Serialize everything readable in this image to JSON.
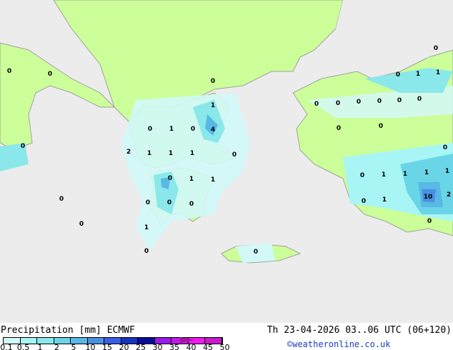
{
  "title": "Precipitation [mm]  ECMWF",
  "valid_time": "Th 23-04-2026 03..06 UTC (06+120)",
  "credit": "©weatheronline.co.uk",
  "colors": {
    "land": "#ccff99",
    "sea": "#ececec",
    "border": "#a0a0a0"
  },
  "colorbar": {
    "ticks": [
      "0.1",
      "0.5",
      "1",
      "2",
      "5",
      "10",
      "15",
      "20",
      "25",
      "30",
      "35",
      "40",
      "45",
      "50"
    ],
    "colors": [
      "#d2f8f8",
      "#a8f5f5",
      "#8ae8ea",
      "#6ad5e6",
      "#58b8e6",
      "#4a90e0",
      "#3a5ce8",
      "#1a32c0",
      "#0a0a9a",
      "#9a1ae8",
      "#c01ae8",
      "#f01af0",
      "#c81ac8",
      "#a0189e"
    ]
  },
  "map": {
    "labels": [
      "0",
      "0",
      "0",
      "1",
      "0",
      "1",
      "0",
      "4",
      "2",
      "1",
      "1",
      "1",
      "0",
      "0",
      "0",
      "1",
      "1",
      "0",
      "0",
      "0",
      "0",
      "0",
      "1",
      "0",
      "0",
      "0",
      "0",
      "1",
      "1",
      "0",
      "0",
      "0",
      "0",
      "0",
      "0",
      "0",
      "0",
      "0",
      "0",
      "1",
      "1",
      "1",
      "1",
      "0",
      "1",
      "10",
      "2",
      "0"
    ]
  }
}
